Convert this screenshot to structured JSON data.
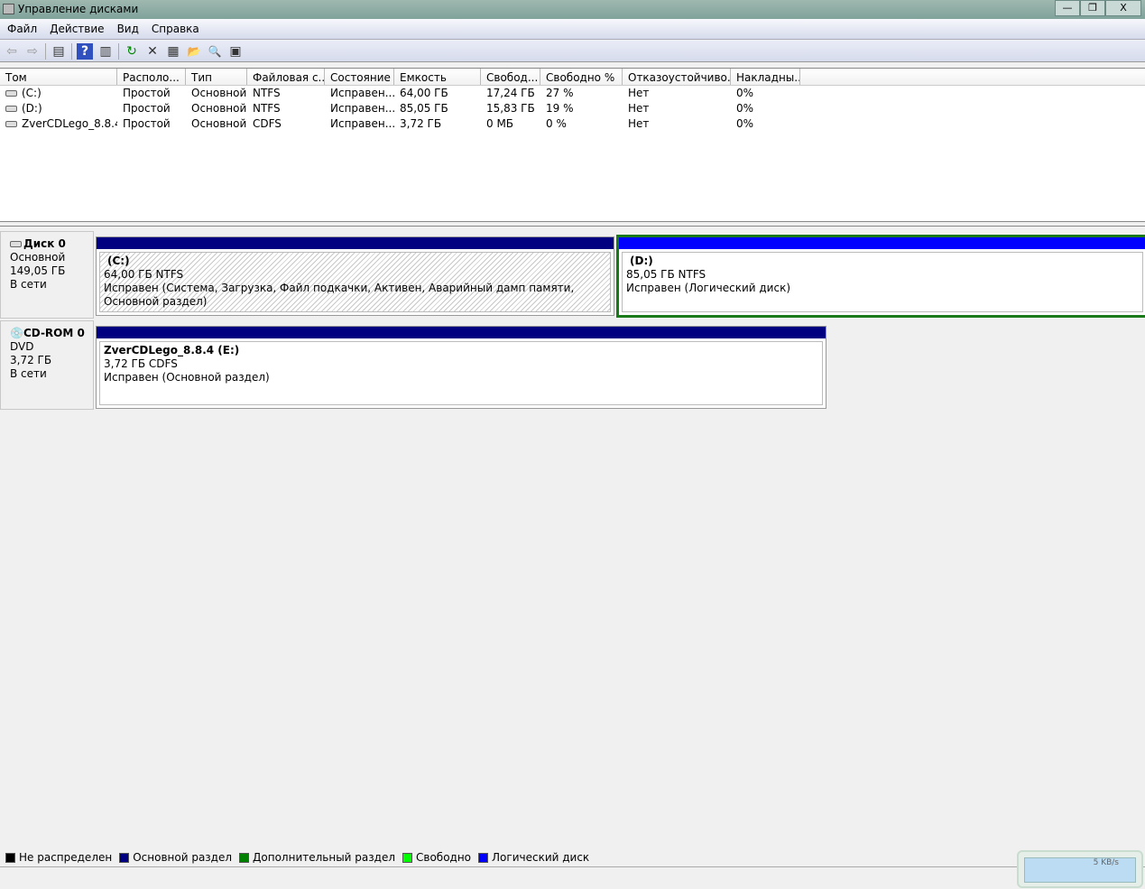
{
  "window": {
    "title": "Управление дисками",
    "buttons": [
      "—",
      "❐",
      "X"
    ]
  },
  "menu": [
    "Файл",
    "Действие",
    "Вид",
    "Справка"
  ],
  "toolbar": [
    {
      "icon": "back-icon",
      "g": "⇦"
    },
    {
      "icon": "forward-icon",
      "g": "⇨"
    },
    {
      "icon": "console-tree-icon",
      "g": "▤"
    },
    {
      "icon": "help-icon",
      "g": "?"
    },
    {
      "icon": "action-pane-icon",
      "g": "▥"
    },
    {
      "icon": "refresh-icon",
      "g": "↻"
    },
    {
      "icon": "delete-icon",
      "g": "✕"
    },
    {
      "icon": "properties-icon",
      "g": "▦"
    },
    {
      "icon": "open-folder-icon",
      "g": "📂"
    },
    {
      "icon": "explore-icon",
      "g": "🔍"
    },
    {
      "icon": "settings-icon",
      "g": "▣"
    }
  ],
  "table": {
    "columns": [
      "Том",
      "Располо...",
      "Тип",
      "Файловая с...",
      "Состояние",
      "Емкость",
      "Свобод...",
      "Свободно %",
      "Отказоустойчиво...",
      "Накладны..."
    ],
    "rows": [
      [
        "(C:)",
        "Простой",
        "Основной",
        "NTFS",
        "Исправен...",
        "64,00 ГБ",
        "17,24 ГБ",
        "27 %",
        "Нет",
        "0%"
      ],
      [
        "(D:)",
        "Простой",
        "Основной",
        "NTFS",
        "Исправен...",
        "85,05 ГБ",
        "15,83 ГБ",
        "19 %",
        "Нет",
        "0%"
      ],
      [
        "ZverCDLego_8.8.4 ...",
        "Простой",
        "Основной",
        "CDFS",
        "Исправен...",
        "3,72 ГБ",
        "0 МБ",
        "0 %",
        "Нет",
        "0%"
      ]
    ]
  },
  "disks": [
    {
      "name": "Диск 0",
      "type": "Основной",
      "size": "149,05 ГБ",
      "status": "В сети",
      "partitions": [
        {
          "title": "(C:)",
          "size": "64,00 ГБ NTFS",
          "state": "Исправен (Система, Загрузка, Файл подкачки, Активен, Аварийный дамп памяти, Основной раздел)",
          "color": "#000080"
        },
        {
          "title": "(D:)",
          "size": "85,05 ГБ NTFS",
          "state": "Исправен (Логический диск)",
          "color": "#0000ff"
        }
      ]
    },
    {
      "name": "CD-ROM 0",
      "type": "DVD",
      "size": "3,72 ГБ",
      "status": "В сети",
      "partitions": [
        {
          "title": "ZverCDLego_8.8.4  (E:)",
          "size": "3,72 ГБ CDFS",
          "state": "Исправен (Основной раздел)",
          "color": "#000080"
        }
      ]
    }
  ],
  "legend": [
    {
      "label": "Не распределен",
      "color": "#000000"
    },
    {
      "label": "Основной раздел",
      "color": "#000080"
    },
    {
      "label": "Дополнительный раздел",
      "color": "#008000"
    },
    {
      "label": "Свободно",
      "color": "#00ff00"
    },
    {
      "label": "Логический диск",
      "color": "#0000ff"
    }
  ],
  "network": {
    "speed": "5 KB/s"
  }
}
